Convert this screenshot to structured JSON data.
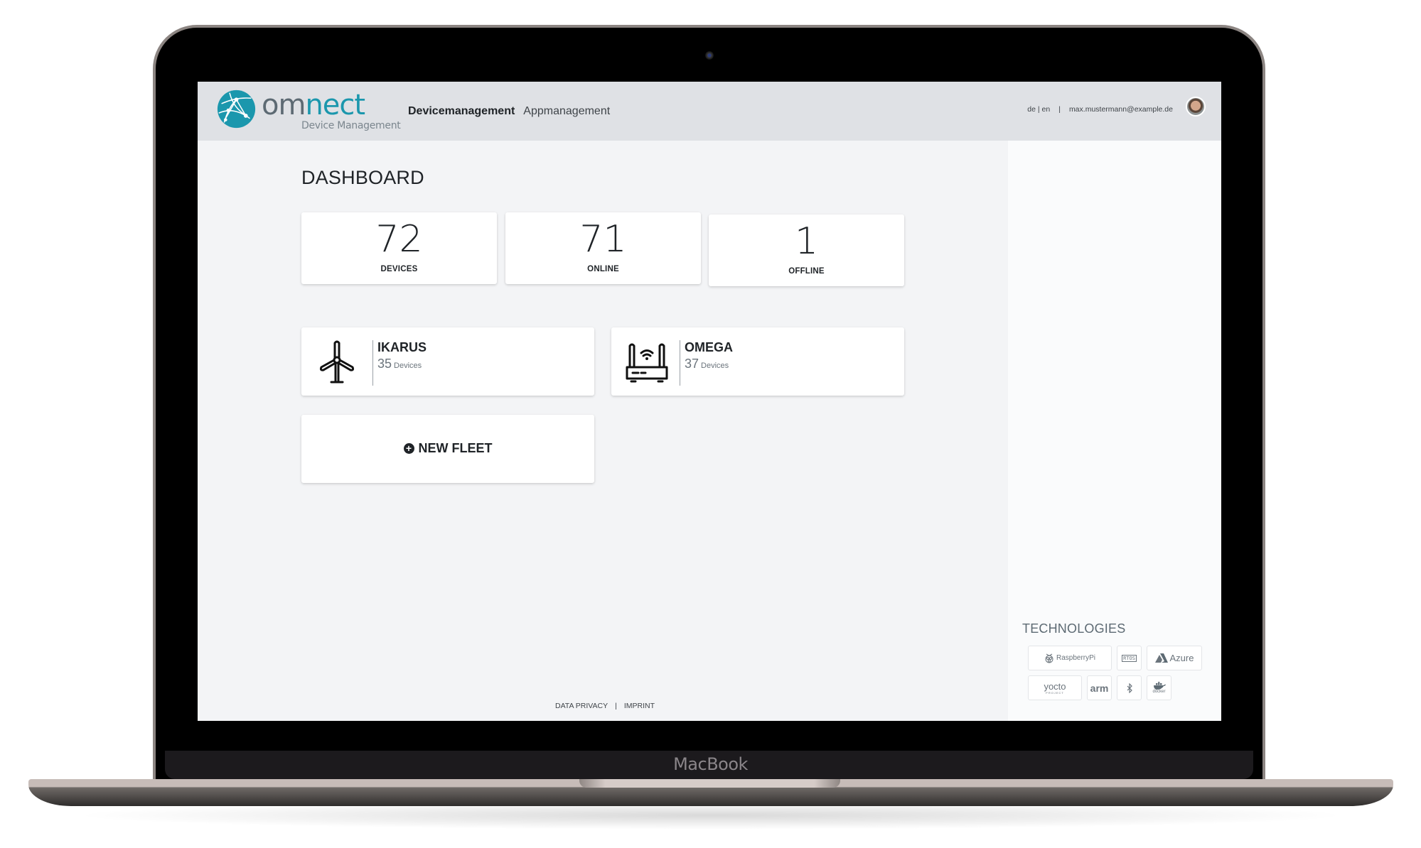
{
  "device_frame": {
    "brand_label": "MacBook"
  },
  "header": {
    "logo": {
      "text_primary": "om",
      "text_accent": "nect",
      "subtitle": "Device Management",
      "icon": "globe-network-icon"
    },
    "nav": [
      {
        "label": "Devicemanagement",
        "active": true
      },
      {
        "label": "Appmanagement",
        "active": false
      }
    ],
    "language": {
      "de": "de",
      "sep": "|",
      "en": "en"
    },
    "separator": "|",
    "user_email": "max.mustermann@example.de",
    "avatar": "user-avatar"
  },
  "main": {
    "title": "DASHBOARD",
    "stats": [
      {
        "value": "72",
        "label": "DEVICES"
      },
      {
        "value": "71",
        "label": "ONLINE"
      },
      {
        "value": "1",
        "label": "OFFLINE"
      }
    ],
    "fleets": [
      {
        "name": "IKARUS",
        "count": "35",
        "unit": "Devices",
        "icon": "wind-turbine-icon"
      },
      {
        "name": "OMEGA",
        "count": "37",
        "unit": "Devices",
        "icon": "wifi-router-icon"
      }
    ],
    "new_fleet": {
      "label": "NEW FLEET",
      "icon": "plus-circle-icon"
    }
  },
  "footer": {
    "data_privacy": "DATA PRIVACY",
    "separator": "|",
    "imprint": "IMPRINT"
  },
  "side_panel": {
    "technologies_title": "TECHNOLOGIES",
    "technologies": [
      {
        "label": "RaspberryPi",
        "icon": "raspberry-pi-icon"
      },
      {
        "label": "RTOS",
        "icon": "rtos-icon"
      },
      {
        "label": "Azure",
        "icon": "azure-icon"
      },
      {
        "label": "yocto",
        "sub": "PROJECT",
        "icon": "yocto-icon"
      },
      {
        "label": "arm",
        "icon": "arm-icon"
      },
      {
        "label": "",
        "icon": "bluetooth-icon"
      },
      {
        "label": "docker",
        "icon": "docker-icon"
      }
    ]
  },
  "colors": {
    "accent": "#1b97ad",
    "header_bg": "#dfe1e5",
    "page_bg": "#f3f4f6",
    "text_dark": "#1f2327"
  }
}
